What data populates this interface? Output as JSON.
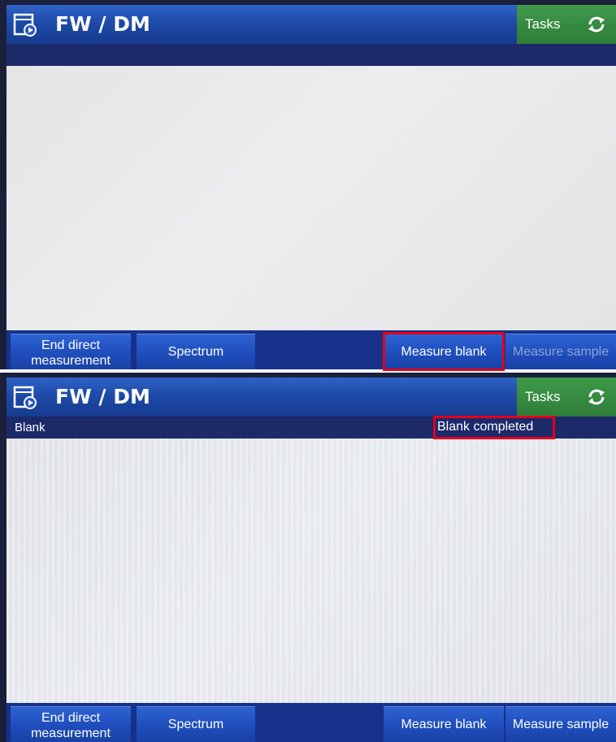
{
  "app": {
    "title": "FW / DM",
    "tasks_label": "Tasks"
  },
  "icons": {
    "app": "panel-play-icon",
    "tasks": "refresh-icon"
  },
  "colors": {
    "titlebar_blue": "#1e4aa8",
    "tasks_green": "#2e7d38",
    "status_bar": "#1c2a6a",
    "toolbar": "#17308a",
    "highlight_red": "#e3001b"
  },
  "screens": [
    {
      "status_left": "",
      "status_right": "",
      "toolbar": {
        "end_line1": "End direct",
        "end_line2": "measurement",
        "spectrum": "Spectrum",
        "measure_blank": "Measure blank",
        "measure_sample": "Measure sample"
      }
    },
    {
      "status_left": "Blank",
      "status_right": "Blank completed",
      "toolbar": {
        "end_line1": "End direct",
        "end_line2": "measurement",
        "spectrum": "Spectrum",
        "measure_blank": "Measure blank",
        "measure_sample": "Measure sample"
      }
    }
  ]
}
